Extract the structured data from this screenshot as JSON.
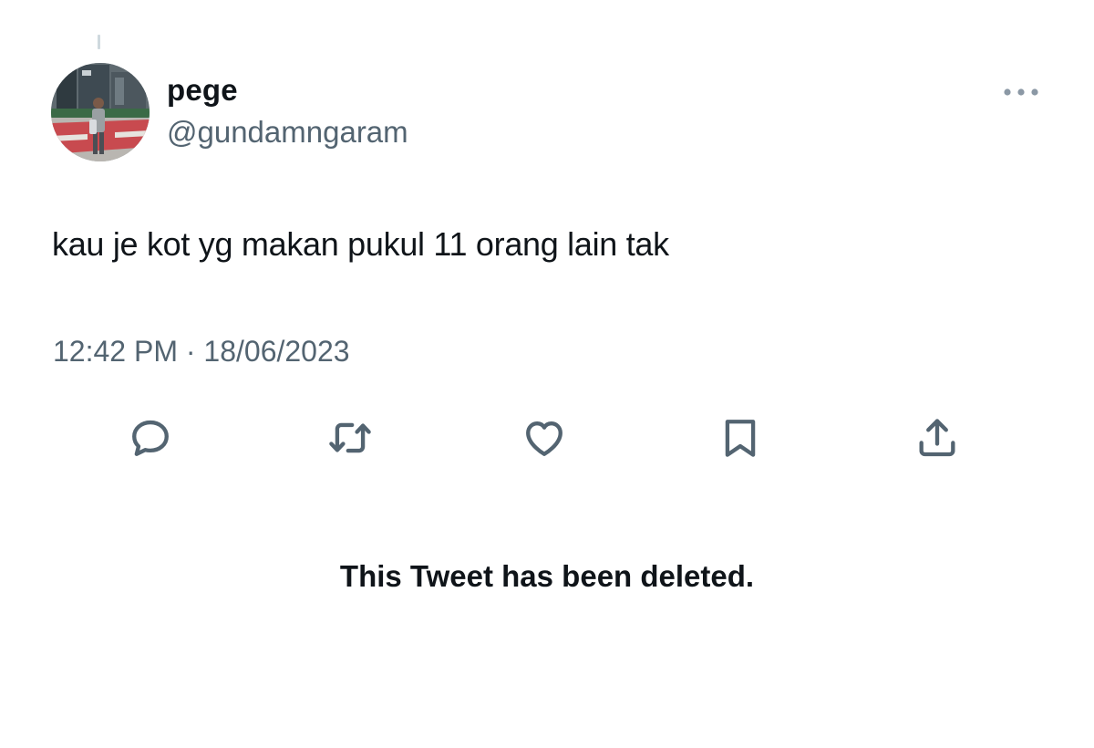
{
  "tweet": {
    "display_name": "pege",
    "handle": "@gundamngaram",
    "text": "kau je kot yg makan pukul 11 orang lain tak",
    "timestamp": "12:42 PM · 18/06/2023"
  },
  "actions": [
    {
      "icon": "reply-icon"
    },
    {
      "icon": "retweet-icon"
    },
    {
      "icon": "like-icon"
    },
    {
      "icon": "bookmark-icon"
    },
    {
      "icon": "share-icon"
    }
  ],
  "notice": "This Tweet has been deleted.",
  "colors": {
    "text_primary": "#0f1419",
    "text_secondary": "#536471",
    "icon": "#536471",
    "thread_line": "#cfd9de",
    "background": "#ffffff"
  }
}
